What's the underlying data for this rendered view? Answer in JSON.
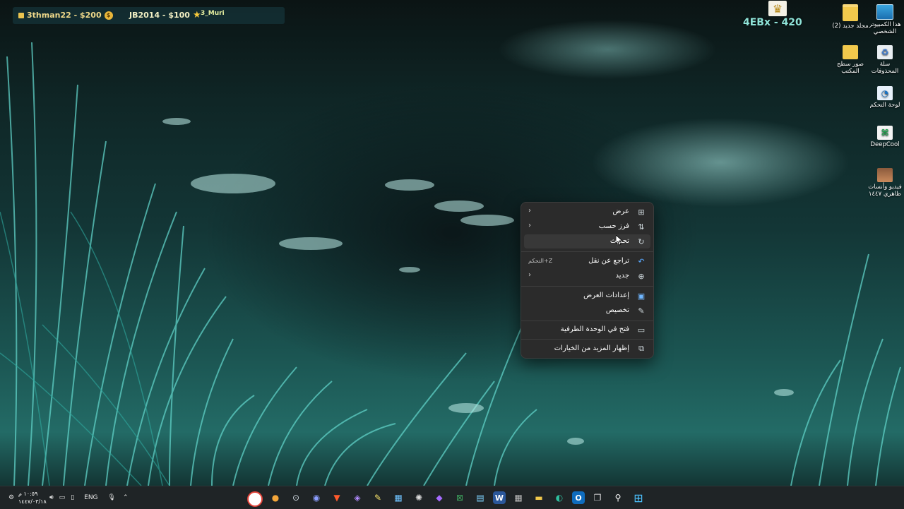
{
  "overlay": {
    "leaderboard": [
      {
        "name": "3thman22 - $200"
      },
      {
        "name": "JB2014 - $100"
      },
      {
        "name": "3_Muri"
      }
    ],
    "top_right_score": "4EBx - 420"
  },
  "desktop_icons": [
    {
      "label": "هذا الكمبيوتر الشخصي",
      "icon": "computer-icon"
    },
    {
      "label": "مجلد جديد (2)",
      "icon": "folder-icon"
    },
    {
      "label": "سلة المحذوفات",
      "icon": "recycle-bin-icon"
    },
    {
      "label": "صور سطح المكتب",
      "icon": "folder-icon"
    },
    {
      "label": "لوحة التحكم",
      "icon": "control-panel-icon"
    },
    {
      "label": "DeepCool",
      "icon": "deepcool-icon"
    },
    {
      "label": "فيديو وأنسات ظاهري ١٤٤٧",
      "icon": "image-file-icon"
    }
  ],
  "context_menu": {
    "items": [
      {
        "label": "عرض",
        "icon": "grid-icon",
        "has_submenu": true
      },
      {
        "label": "فرز حسب",
        "icon": "sort-icon",
        "has_submenu": true
      },
      {
        "label": "تحديث",
        "icon": "refresh-icon",
        "hovered": true
      },
      {
        "label": "تراجع عن نقل",
        "icon": "undo-icon",
        "shortcut": "التحكم+Z"
      },
      {
        "label": "جديد",
        "icon": "plus-circle-icon",
        "has_submenu": true
      },
      {
        "label": "إعدادات العرض",
        "icon": "display-settings-icon"
      },
      {
        "label": "تخصيص",
        "icon": "pen-icon"
      },
      {
        "label": "فتح في الوحدة الطرفية",
        "icon": "terminal-icon"
      },
      {
        "label": "إظهار المزيد من الخيارات",
        "icon": "more-options-icon"
      }
    ]
  },
  "taskbar": {
    "clock_time": "١٠:٥٩ م",
    "clock_date": "١٤٤٧/٠٣/١٨",
    "language": "ENG",
    "apps": [
      "chrome",
      "paint",
      "steam",
      "discord",
      "brave",
      "emulator",
      "notes",
      "store",
      "chatgpt",
      "obsidian",
      "xbox",
      "notepad",
      "word",
      "calculator",
      "explorer",
      "edge",
      "outlook",
      "task-view",
      "search",
      "start"
    ]
  },
  "colors": {
    "menu_bg": "#2b2b2b",
    "taskbar_bg": "#1f2426",
    "score_text": "#8fe3d8"
  }
}
